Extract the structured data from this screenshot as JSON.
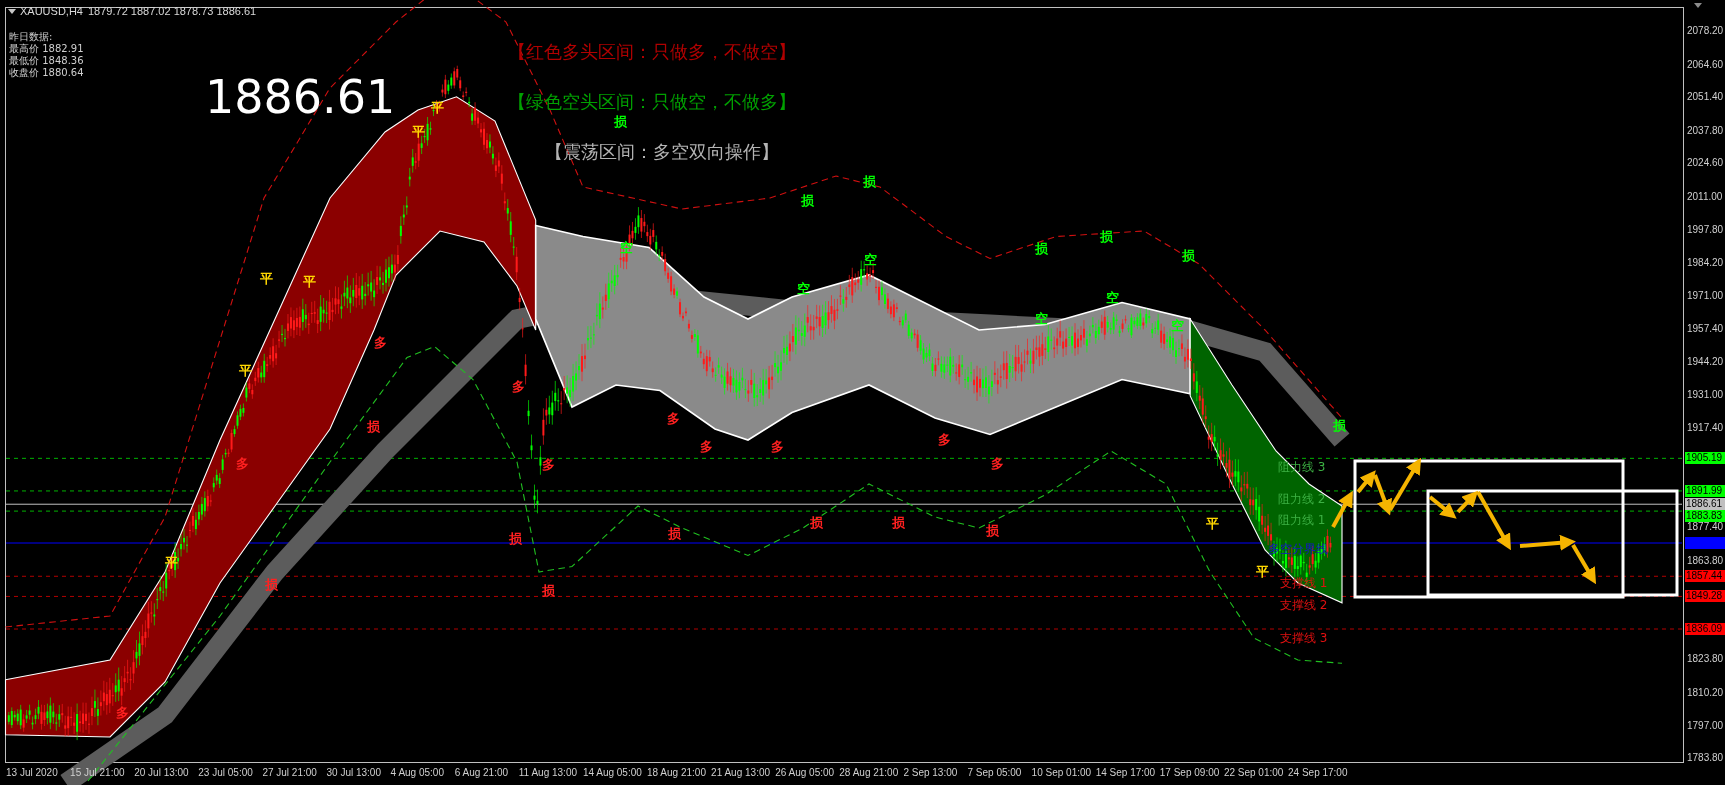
{
  "header": {
    "symbol": "XAUUSD,H4",
    "ohlc": "1879.72 1887.02 1878.73 1886.61"
  },
  "yesterday": [
    "昨日数据:",
    "最高价 1882.91",
    "最低价 1848.36",
    "收盘价 1880.64"
  ],
  "current_price": "1886.61",
  "legend": [
    {
      "text": "【红色多头区间：只做多，不做空】",
      "kind": "bullish"
    },
    {
      "text": "【绿色空头区间：只做空，不做多】",
      "kind": "bearish"
    },
    {
      "text": "【震荡区间：多空双向操作】",
      "kind": "range"
    }
  ],
  "line_labels": [
    {
      "text": "阻力线 3",
      "kind": "resistance"
    },
    {
      "text": "阻力线 2",
      "kind": "resistance"
    },
    {
      "text": "阻力线 1",
      "kind": "resistance"
    },
    {
      "text": "多空分界线",
      "kind": "pivot"
    },
    {
      "text": "支撑线 1",
      "kind": "support"
    },
    {
      "text": "支撑线 2",
      "kind": "support"
    },
    {
      "text": "支撑线 3",
      "kind": "support"
    }
  ],
  "markers": [
    {
      "text": "平",
      "color": "#ffd700"
    },
    {
      "text": "平",
      "color": "#ffd700"
    },
    {
      "text": "平",
      "color": "#ffd700"
    },
    {
      "text": "平",
      "color": "#ffd700"
    },
    {
      "text": "平",
      "color": "#ffd700"
    },
    {
      "text": "平",
      "color": "#ffd700"
    },
    {
      "text": "平",
      "color": "#ffd700"
    },
    {
      "text": "平",
      "color": "#ffd700"
    },
    {
      "text": "多",
      "color": "#ff2020"
    },
    {
      "text": "多",
      "color": "#ff2020"
    },
    {
      "text": "多",
      "color": "#ff2020"
    },
    {
      "text": "多",
      "color": "#ff2020"
    },
    {
      "text": "多",
      "color": "#ff2020"
    },
    {
      "text": "多",
      "color": "#ff2020"
    },
    {
      "text": "多",
      "color": "#ff2020"
    },
    {
      "text": "多",
      "color": "#ff2020"
    },
    {
      "text": "多",
      "color": "#ff2020"
    },
    {
      "text": "多",
      "color": "#ff2020"
    },
    {
      "text": "空",
      "color": "#00ff00"
    },
    {
      "text": "空",
      "color": "#00ff00"
    },
    {
      "text": "空",
      "color": "#00ff00"
    },
    {
      "text": "空",
      "color": "#00ff00"
    },
    {
      "text": "空",
      "color": "#00ff00"
    },
    {
      "text": "空",
      "color": "#00ff00"
    },
    {
      "text": "损",
      "color": "#00ff00"
    },
    {
      "text": "损",
      "color": "#00ff00"
    },
    {
      "text": "损",
      "color": "#00ff00"
    },
    {
      "text": "损",
      "color": "#00ff00"
    },
    {
      "text": "损",
      "color": "#00ff00"
    },
    {
      "text": "损",
      "color": "#00ff00"
    },
    {
      "text": "损",
      "color": "#00ff00"
    },
    {
      "text": "损",
      "color": "#ff2020"
    },
    {
      "text": "损",
      "color": "#ff2020"
    },
    {
      "text": "损",
      "color": "#ff2020"
    },
    {
      "text": "损",
      "color": "#ff2020"
    },
    {
      "text": "损",
      "color": "#ff2020"
    },
    {
      "text": "损",
      "color": "#ff2020"
    },
    {
      "text": "损",
      "color": "#ff2020"
    },
    {
      "text": "损",
      "color": "#ff2020"
    }
  ],
  "price_axis": [
    "2078.20",
    "2064.60",
    "2051.40",
    "2037.80",
    "2024.60",
    "2011.00",
    "1997.80",
    "1984.20",
    "1971.00",
    "1957.40",
    "1944.20",
    "1931.00",
    "1917.40",
    "1877.40",
    "1863.80",
    "1823.80",
    "1810.20",
    "1797.00",
    "1783.80"
  ],
  "price_tags": [
    {
      "label": "1905.19",
      "color": "#00ff00",
      "kind": "level"
    },
    {
      "label": "1891.99",
      "color": "#00ff00",
      "kind": "level"
    },
    {
      "label": "1886.61",
      "color": "#c0c0c0",
      "kind": "current"
    },
    {
      "label": "1883.83",
      "color": "#00ff00",
      "kind": "level"
    },
    {
      "color": "#0000ff",
      "kind": "pivot"
    },
    {
      "label": "1857.44",
      "color": "#ff0000",
      "kind": "level"
    },
    {
      "label": "1849.28",
      "color": "#ff0000",
      "kind": "level"
    },
    {
      "label": "1836.09",
      "color": "#ff0000",
      "kind": "level"
    }
  ],
  "time_axis": [
    "13 Jul 2020",
    "15 Jul 21:00",
    "20 Jul 13:00",
    "23 Jul 05:00",
    "27 Jul 21:00",
    "30 Jul 13:00",
    "4 Aug 05:00",
    "6 Aug 21:00",
    "11 Aug 13:00",
    "14 Aug 05:00",
    "18 Aug 21:00",
    "21 Aug 13:00",
    "26 Aug 05:00",
    "28 Aug 21:00",
    "2 Sep 13:00",
    "7 Sep 05:00",
    "10 Sep 01:00",
    "14 Sep 17:00",
    "17 Sep 09:00",
    "22 Sep 01:00",
    "24 Sep 17:00"
  ]
}
